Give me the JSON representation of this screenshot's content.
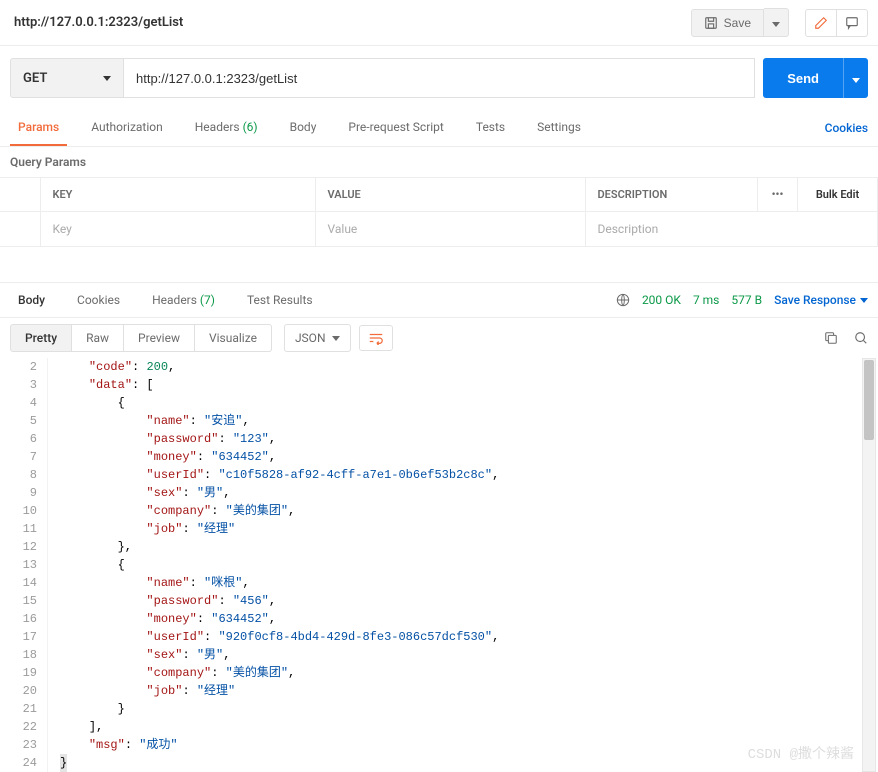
{
  "header": {
    "title": "http://127.0.0.1:2323/getList",
    "save_label": "Save"
  },
  "request": {
    "method": "GET",
    "url": "http://127.0.0.1:2323/getList",
    "send_label": "Send",
    "tabs": [
      {
        "label": "Params",
        "active": true
      },
      {
        "label": "Authorization"
      },
      {
        "label": "Headers",
        "count": "(6)"
      },
      {
        "label": "Body"
      },
      {
        "label": "Pre-request Script"
      },
      {
        "label": "Tests"
      },
      {
        "label": "Settings"
      }
    ],
    "cookies_link": "Cookies",
    "query_params_title": "Query Params",
    "columns": {
      "key": "KEY",
      "value": "VALUE",
      "description": "DESCRIPTION",
      "bulk": "Bulk Edit"
    },
    "placeholders": {
      "key": "Key",
      "value": "Value",
      "description": "Description"
    }
  },
  "response": {
    "tabs": [
      {
        "label": "Body",
        "active": true
      },
      {
        "label": "Cookies"
      },
      {
        "label": "Headers",
        "count": "(7)"
      },
      {
        "label": "Test Results"
      }
    ],
    "status": {
      "code": "200 OK",
      "time": "7 ms",
      "size": "577 B"
    },
    "save_response": "Save Response",
    "views": [
      {
        "label": "Pretty",
        "active": true
      },
      {
        "label": "Raw"
      },
      {
        "label": "Preview"
      },
      {
        "label": "Visualize"
      }
    ],
    "format": "JSON",
    "body_lines": [
      {
        "n": 2,
        "indent": 1,
        "parts": [
          {
            "t": "key",
            "v": "\"code\""
          },
          {
            "t": "pun",
            "v": ": "
          },
          {
            "t": "num",
            "v": "200"
          },
          {
            "t": "pun",
            "v": ","
          }
        ]
      },
      {
        "n": 3,
        "indent": 1,
        "parts": [
          {
            "t": "key",
            "v": "\"data\""
          },
          {
            "t": "pun",
            "v": ": ["
          }
        ]
      },
      {
        "n": 4,
        "indent": 2,
        "parts": [
          {
            "t": "pun",
            "v": "{"
          }
        ]
      },
      {
        "n": 5,
        "indent": 3,
        "parts": [
          {
            "t": "key",
            "v": "\"name\""
          },
          {
            "t": "pun",
            "v": ": "
          },
          {
            "t": "str",
            "v": "\"安追\""
          },
          {
            "t": "pun",
            "v": ","
          }
        ]
      },
      {
        "n": 6,
        "indent": 3,
        "parts": [
          {
            "t": "key",
            "v": "\"password\""
          },
          {
            "t": "pun",
            "v": ": "
          },
          {
            "t": "str",
            "v": "\"123\""
          },
          {
            "t": "pun",
            "v": ","
          }
        ]
      },
      {
        "n": 7,
        "indent": 3,
        "parts": [
          {
            "t": "key",
            "v": "\"money\""
          },
          {
            "t": "pun",
            "v": ": "
          },
          {
            "t": "str",
            "v": "\"634452\""
          },
          {
            "t": "pun",
            "v": ","
          }
        ]
      },
      {
        "n": 8,
        "indent": 3,
        "parts": [
          {
            "t": "key",
            "v": "\"userId\""
          },
          {
            "t": "pun",
            "v": ": "
          },
          {
            "t": "str",
            "v": "\"c10f5828-af92-4cff-a7e1-0b6ef53b2c8c\""
          },
          {
            "t": "pun",
            "v": ","
          }
        ]
      },
      {
        "n": 9,
        "indent": 3,
        "parts": [
          {
            "t": "key",
            "v": "\"sex\""
          },
          {
            "t": "pun",
            "v": ": "
          },
          {
            "t": "str",
            "v": "\"男\""
          },
          {
            "t": "pun",
            "v": ","
          }
        ]
      },
      {
        "n": 10,
        "indent": 3,
        "parts": [
          {
            "t": "key",
            "v": "\"company\""
          },
          {
            "t": "pun",
            "v": ": "
          },
          {
            "t": "str",
            "v": "\"美的集团\""
          },
          {
            "t": "pun",
            "v": ","
          }
        ]
      },
      {
        "n": 11,
        "indent": 3,
        "parts": [
          {
            "t": "key",
            "v": "\"job\""
          },
          {
            "t": "pun",
            "v": ": "
          },
          {
            "t": "str",
            "v": "\"经理\""
          }
        ]
      },
      {
        "n": 12,
        "indent": 2,
        "parts": [
          {
            "t": "pun",
            "v": "},"
          }
        ]
      },
      {
        "n": 13,
        "indent": 2,
        "parts": [
          {
            "t": "pun",
            "v": "{"
          }
        ]
      },
      {
        "n": 14,
        "indent": 3,
        "parts": [
          {
            "t": "key",
            "v": "\"name\""
          },
          {
            "t": "pun",
            "v": ": "
          },
          {
            "t": "str",
            "v": "\"咪根\""
          },
          {
            "t": "pun",
            "v": ","
          }
        ]
      },
      {
        "n": 15,
        "indent": 3,
        "parts": [
          {
            "t": "key",
            "v": "\"password\""
          },
          {
            "t": "pun",
            "v": ": "
          },
          {
            "t": "str",
            "v": "\"456\""
          },
          {
            "t": "pun",
            "v": ","
          }
        ]
      },
      {
        "n": 16,
        "indent": 3,
        "parts": [
          {
            "t": "key",
            "v": "\"money\""
          },
          {
            "t": "pun",
            "v": ": "
          },
          {
            "t": "str",
            "v": "\"634452\""
          },
          {
            "t": "pun",
            "v": ","
          }
        ]
      },
      {
        "n": 17,
        "indent": 3,
        "parts": [
          {
            "t": "key",
            "v": "\"userId\""
          },
          {
            "t": "pun",
            "v": ": "
          },
          {
            "t": "str",
            "v": "\"920f0cf8-4bd4-429d-8fe3-086c57dcf530\""
          },
          {
            "t": "pun",
            "v": ","
          }
        ]
      },
      {
        "n": 18,
        "indent": 3,
        "parts": [
          {
            "t": "key",
            "v": "\"sex\""
          },
          {
            "t": "pun",
            "v": ": "
          },
          {
            "t": "str",
            "v": "\"男\""
          },
          {
            "t": "pun",
            "v": ","
          }
        ]
      },
      {
        "n": 19,
        "indent": 3,
        "parts": [
          {
            "t": "key",
            "v": "\"company\""
          },
          {
            "t": "pun",
            "v": ": "
          },
          {
            "t": "str",
            "v": "\"美的集团\""
          },
          {
            "t": "pun",
            "v": ","
          }
        ]
      },
      {
        "n": 20,
        "indent": 3,
        "parts": [
          {
            "t": "key",
            "v": "\"job\""
          },
          {
            "t": "pun",
            "v": ": "
          },
          {
            "t": "str",
            "v": "\"经理\""
          }
        ]
      },
      {
        "n": 21,
        "indent": 2,
        "parts": [
          {
            "t": "pun",
            "v": "}"
          }
        ]
      },
      {
        "n": 22,
        "indent": 1,
        "parts": [
          {
            "t": "pun",
            "v": "],"
          }
        ]
      },
      {
        "n": 23,
        "indent": 1,
        "parts": [
          {
            "t": "key",
            "v": "\"msg\""
          },
          {
            "t": "pun",
            "v": ": "
          },
          {
            "t": "str",
            "v": "\"成功\""
          }
        ]
      },
      {
        "n": 24,
        "indent": 0,
        "parts": [
          {
            "t": "pun",
            "v": "}"
          }
        ],
        "hl": true
      }
    ]
  },
  "watermark": "CSDN @撒个辣酱"
}
